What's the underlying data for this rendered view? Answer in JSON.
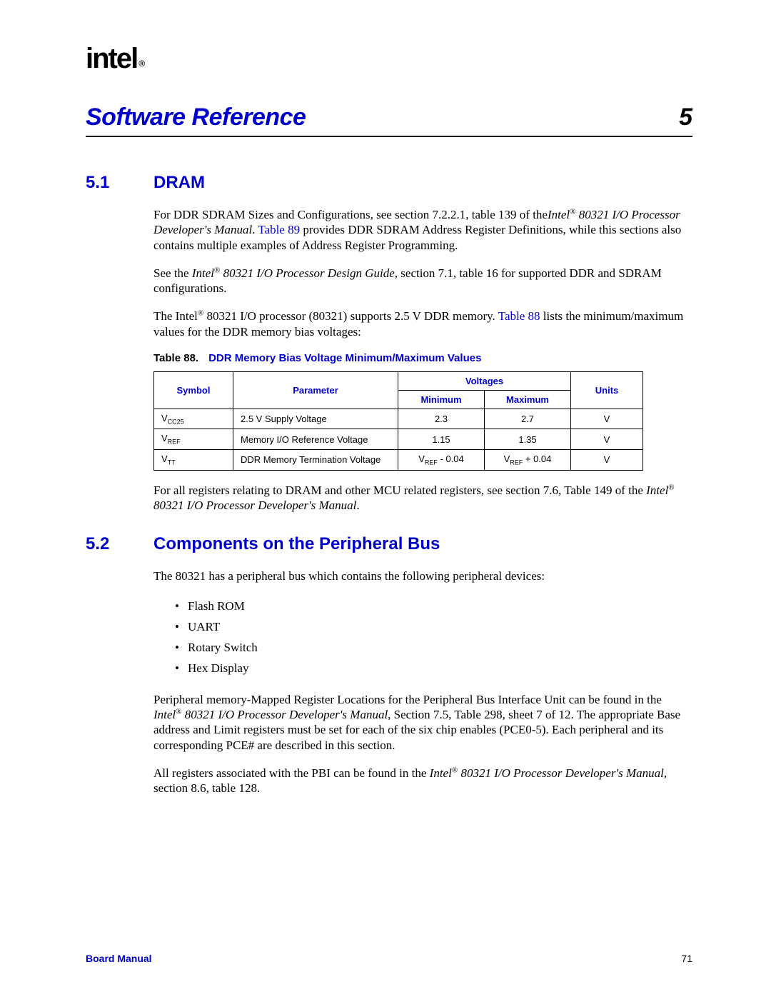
{
  "logo": {
    "text": "intel",
    "reg": "®"
  },
  "chapter": {
    "title": "Software Reference",
    "number": "5"
  },
  "section51": {
    "num": "5.1",
    "title": "DRAM",
    "para1a": "For DDR SDRAM Sizes and Configurations, see section 7.2.2.1, table 139 of the",
    "para1b": "Intel",
    "para1c": " 80321 I/O Processor Developer's Manual",
    "para1d": ". ",
    "para1link": "Table 89",
    "para1e": " provides DDR SDRAM Address Register Definitions, while this sections also contains multiple examples of Address Register Programming.",
    "para2a": "See the ",
    "para2b": "Intel",
    "para2c": " 80321 I/O Processor Design Guide",
    "para2d": ", section 7.1, table 16 for supported DDR and SDRAM configurations.",
    "para3a": "The Intel",
    "para3b": " 80321 I/O processor (80321) supports 2.5 V DDR memory. ",
    "para3link": "Table 88",
    "para3c": " lists the minimum/maximum values for the DDR memory bias voltages:",
    "tableCaptionLbl": "Table 88.",
    "tableCaption": "DDR Memory Bias Voltage Minimum/Maximum Values",
    "th_symbol": "Symbol",
    "th_parameter": "Parameter",
    "th_voltages": "Voltages",
    "th_min": "Minimum",
    "th_max": "Maximum",
    "th_units": "Units",
    "r1_sym_a": "V",
    "r1_sym_b": "CC25",
    "r1_param": "2.5 V Supply Voltage",
    "r1_min": "2.3",
    "r1_max": "2.7",
    "r1_units": "V",
    "r2_sym_a": "V",
    "r2_sym_b": "REF",
    "r2_param": "Memory I/O Reference Voltage",
    "r2_min": "1.15",
    "r2_max": "1.35",
    "r2_units": "V",
    "r3_sym_a": "V",
    "r3_sym_b": "TT",
    "r3_param": "DDR Memory Termination Voltage",
    "r3_min_a": "V",
    "r3_min_b": "REF",
    "r3_min_c": " - 0.04",
    "r3_max_a": "V",
    "r3_max_b": "REF",
    "r3_max_c": " + 0.04",
    "r3_units": "V",
    "para4a": "For all registers relating to DRAM and other MCU related registers, see section 7.6, Table 149 of the ",
    "para4b": "Intel",
    "para4c": " 80321 I/O Processor Developer's Manual",
    "para4d": "."
  },
  "section52": {
    "num": "5.2",
    "title": "Components on the Peripheral Bus",
    "para1": "The 80321 has a peripheral bus which contains the following peripheral devices:",
    "li1": "Flash ROM",
    "li2": "UART",
    "li3": "Rotary Switch",
    "li4": "Hex Display",
    "para2a": "Peripheral memory-Mapped Register Locations for the Peripheral Bus Interface Unit can be found in the ",
    "para2b": "Intel",
    "para2c": " 80321 I/O Processor Developer's Manual",
    "para2d": ", Section 7.5, Table 298, sheet 7 of 12. The appropriate Base address and Limit registers must be set for each of the six chip enables (PCE0-5). Each peripheral and its corresponding PCE# are described in this section.",
    "para3a": "All registers associated with the PBI can be found in the ",
    "para3b": "Intel",
    "para3c": " 80321 I/O Processor Developer's Manual",
    "para3d": ", section 8.6, table 128."
  },
  "footer": {
    "left": "Board Manual",
    "right": "71"
  },
  "reg": "®"
}
